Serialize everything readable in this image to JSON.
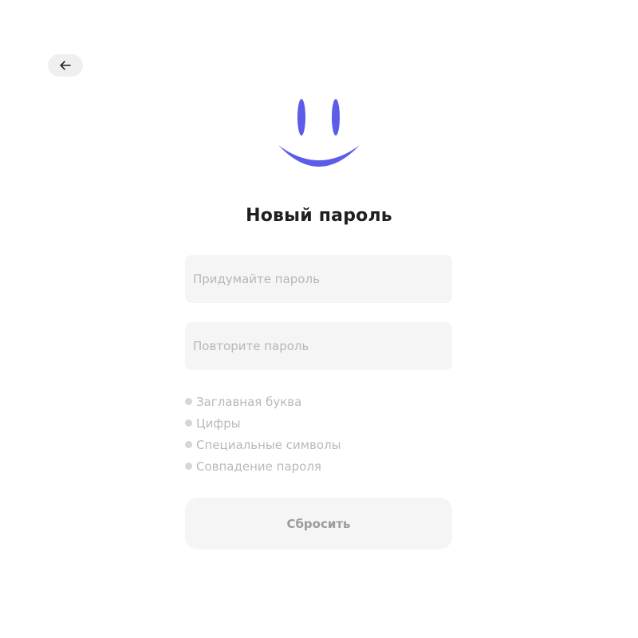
{
  "navigation": {
    "back_icon": "arrow-left-icon"
  },
  "logo": {
    "icon": "smiley-face-icon",
    "color": "#5b5ce8"
  },
  "page_title": "Новый пароль",
  "form": {
    "new_password": {
      "placeholder": "Придумайте пароль",
      "value": ""
    },
    "repeat_password": {
      "placeholder": "Повторите пароль",
      "value": ""
    },
    "requirements": [
      {
        "label": "Заглавная буква"
      },
      {
        "label": "Цифры"
      },
      {
        "label": "Специальные символы"
      },
      {
        "label": "Совпадение пароля"
      }
    ],
    "submit_label": "Сбросить"
  },
  "colors": {
    "accent": "#5b5ce8",
    "field_background": "#f5f5f5",
    "placeholder": "#b7b7b7",
    "requirement_inactive": "#d6d6d6"
  }
}
